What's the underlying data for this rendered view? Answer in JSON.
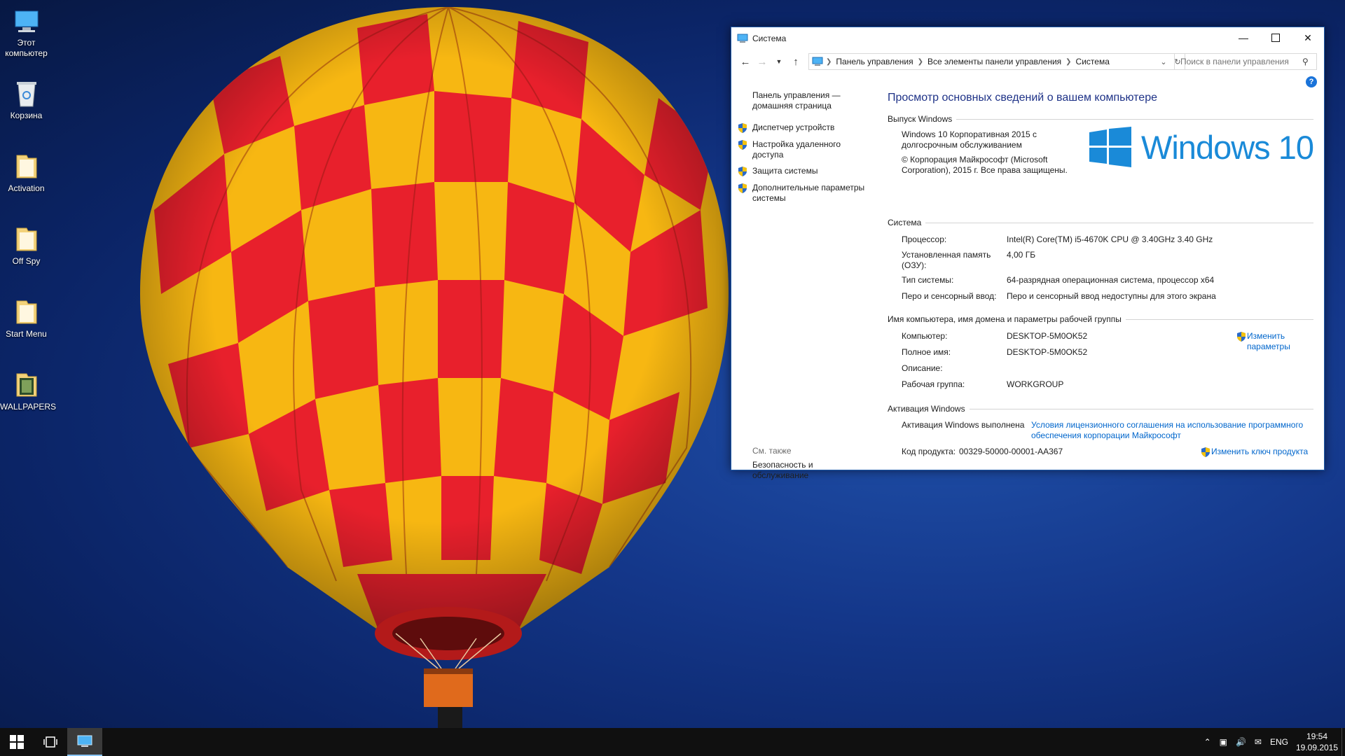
{
  "desktop": {
    "icons": [
      {
        "label": "Этот компьютер"
      },
      {
        "label": "Корзина"
      },
      {
        "label": "Activation"
      },
      {
        "label": "Off Spy"
      },
      {
        "label": "Start Menu"
      },
      {
        "label": "WALLPAPERS"
      }
    ]
  },
  "window": {
    "title": "Система",
    "address": {
      "crumbs": [
        "Панель управления",
        "Все элементы панели управления",
        "Система"
      ]
    },
    "search_placeholder": "Поиск в панели управления",
    "help": "?",
    "left_pane": {
      "home_link": "Панель управления — домашняя страница",
      "links": [
        "Диспетчер устройств",
        "Настройка удаленного доступа",
        "Защита системы",
        "Дополнительные параметры системы"
      ],
      "see_also": "См. также",
      "see_also_link": "Безопасность и обслуживание"
    },
    "main": {
      "title": "Просмотр основных сведений о вашем компьютере",
      "edition_section": "Выпуск Windows",
      "edition": "Windows 10 Корпоративная 2015 с долгосрочным обслуживанием",
      "copyright": "© Корпорация Майкрософт (Microsoft Corporation), 2015 г. Все права защищены.",
      "logo_text": "Windows 10",
      "system_section": "Система",
      "system_rows": [
        {
          "label": "Процессор:",
          "value": "Intel(R) Core(TM) i5-4670K CPU @ 3.40GHz   3.40 GHz"
        },
        {
          "label": "Установленная память (ОЗУ):",
          "value": "4,00 ГБ"
        },
        {
          "label": "Тип системы:",
          "value": "64-разрядная операционная система, процессор x64"
        },
        {
          "label": "Перо и сенсорный ввод:",
          "value": "Перо и сенсорный ввод недоступны для этого экрана"
        }
      ],
      "name_section": "Имя компьютера, имя домена и параметры рабочей группы",
      "name_rows": [
        {
          "label": "Компьютер:",
          "value": "DESKTOP-5M0OK52"
        },
        {
          "label": "Полное имя:",
          "value": "DESKTOP-5M0OK52"
        },
        {
          "label": "Описание:",
          "value": ""
        },
        {
          "label": "Рабочая группа:",
          "value": "WORKGROUP"
        }
      ],
      "change_settings": "Изменить параметры",
      "activation_section": "Активация Windows",
      "activation_status": "Активация Windows выполнена",
      "license_link": "Условия лицензионного соглашения на использование программного обеспечения корпорации Майкрософт",
      "product_key_label": "Код продукта:",
      "product_key": "00329-50000-00001-AA367",
      "change_key": "Изменить ключ продукта"
    }
  },
  "taskbar": {
    "lang": "ENG",
    "time": "19:54",
    "date": "19.09.2015"
  },
  "colors": {
    "accent": "#1a8ad8",
    "link": "#0066cc",
    "title": "#1e3287"
  }
}
